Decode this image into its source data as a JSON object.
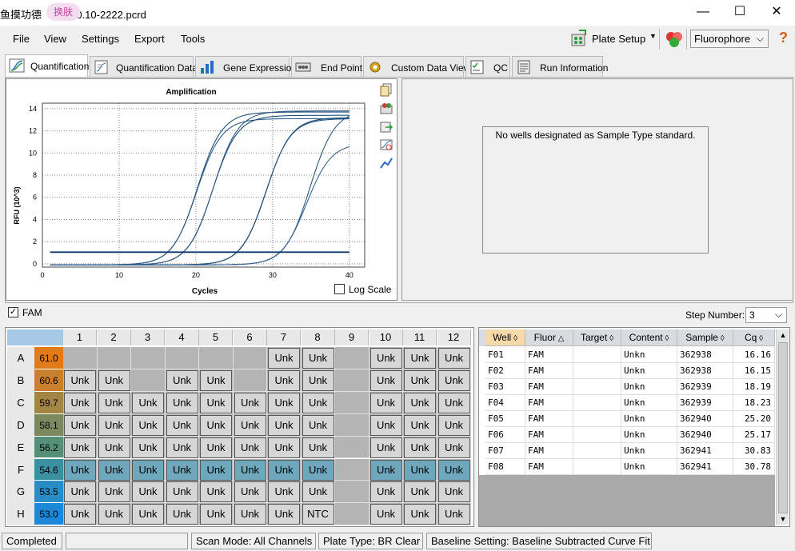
{
  "window": {
    "title": "鱼摸功德     s - 10.10-2222.pcrd",
    "skin_button": "换肤",
    "minimize": "—",
    "maximize": "☐",
    "close": "✕"
  },
  "menu": [
    "File",
    "View",
    "Settings",
    "Export",
    "Tools"
  ],
  "toolbar": {
    "plate_setup": "Plate Setup",
    "fluorophore": "Fluorophore",
    "help": "?"
  },
  "tabs": [
    {
      "label": "Quantification",
      "icon": "amplification-icon"
    },
    {
      "label": "Quantification Data",
      "icon": "data-sheet-icon"
    },
    {
      "label": "Gene Expression",
      "icon": "bar-chart-icon"
    },
    {
      "label": "End Point",
      "icon": "endpoint-icon"
    },
    {
      "label": "Custom Data View",
      "icon": "gear-icon"
    },
    {
      "label": "QC",
      "icon": "checklist-icon"
    },
    {
      "label": "Run Information",
      "icon": "document-icon"
    }
  ],
  "chart_data": {
    "type": "line",
    "title": "Amplification",
    "xlabel": "Cycles",
    "ylabel": "RFU (10^3)",
    "xlim": [
      0,
      42
    ],
    "ylim": [
      -0.3,
      14.5
    ],
    "xticks": [
      0,
      10,
      20,
      30,
      40
    ],
    "yticks": [
      0,
      2,
      4,
      6,
      8,
      10,
      12,
      14
    ],
    "threshold": 1.05,
    "log_scale": false,
    "log_scale_label": "Log Scale",
    "grid": true,
    "series": [
      {
        "cq": 16.16,
        "plateau": 13.8,
        "color": "#1f4e79"
      },
      {
        "cq": 16.15,
        "plateau": 13.2,
        "color": "#2b5d8c"
      },
      {
        "cq": 18.19,
        "plateau": 13.5,
        "color": "#1f4e79"
      },
      {
        "cq": 18.23,
        "plateau": 13.9,
        "color": "#355f88"
      },
      {
        "cq": 25.2,
        "plateau": 13.3,
        "color": "#1f4e79"
      },
      {
        "cq": 25.17,
        "plateau": 13.2,
        "color": "#24527f"
      },
      {
        "cq": 30.83,
        "plateau": 14.0,
        "color": "#2a5a85"
      },
      {
        "cq": 30.78,
        "plateau": 11.0,
        "color": "#3a6690"
      }
    ]
  },
  "standard_panel": {
    "message": "No wells designated as Sample Type standard."
  },
  "fam": {
    "label": "FAM",
    "checked": true
  },
  "step": {
    "label": "Step Number:",
    "value": "3"
  },
  "plate": {
    "columns": [
      "1",
      "2",
      "3",
      "4",
      "5",
      "6",
      "7",
      "8",
      "9",
      "10",
      "11",
      "12"
    ],
    "rows": [
      {
        "label": "A",
        "temp": "61.0",
        "color": "#e07b1a",
        "wells": [
          "",
          "",
          "",
          "",
          "",
          "",
          "Unk",
          "Unk",
          "",
          "Unk",
          "Unk",
          "Unk"
        ]
      },
      {
        "label": "B",
        "temp": "60.6",
        "color": "#c8802e",
        "wells": [
          "Unk",
          "Unk",
          "",
          "Unk",
          "Unk",
          "",
          "Unk",
          "Unk",
          "",
          "Unk",
          "Unk",
          "Unk"
        ]
      },
      {
        "label": "C",
        "temp": "59.7",
        "color": "#a38544",
        "wells": [
          "Unk",
          "Unk",
          "Unk",
          "Unk",
          "Unk",
          "Unk",
          "Unk",
          "Unk",
          "",
          "Unk",
          "Unk",
          "Unk"
        ]
      },
      {
        "label": "D",
        "temp": "58.1",
        "color": "#7b8a5e",
        "wells": [
          "Unk",
          "Unk",
          "Unk",
          "Unk",
          "Unk",
          "Unk",
          "Unk",
          "Unk",
          "",
          "Unk",
          "Unk",
          "Unk"
        ]
      },
      {
        "label": "E",
        "temp": "56.2",
        "color": "#548f79",
        "wells": [
          "Unk",
          "Unk",
          "Unk",
          "Unk",
          "Unk",
          "Unk",
          "Unk",
          "Unk",
          "",
          "Unk",
          "Unk",
          "Unk"
        ]
      },
      {
        "label": "F",
        "temp": "54.6",
        "color": "#3a90a0",
        "wells": [
          "Unk",
          "Unk",
          "Unk",
          "Unk",
          "Unk",
          "Unk",
          "Unk",
          "Unk",
          "",
          "Unk",
          "Unk",
          "Unk"
        ]
      },
      {
        "label": "G",
        "temp": "53.5",
        "color": "#2a8cc4",
        "wells": [
          "Unk",
          "Unk",
          "Unk",
          "Unk",
          "Unk",
          "Unk",
          "Unk",
          "Unk",
          "",
          "Unk",
          "Unk",
          "Unk"
        ]
      },
      {
        "label": "H",
        "temp": "53.0",
        "color": "#1e88d8",
        "wells": [
          "Unk",
          "Unk",
          "Unk",
          "Unk",
          "Unk",
          "Unk",
          "Unk",
          "NTC",
          "",
          "Unk",
          "Unk",
          "Unk"
        ]
      }
    ],
    "highlight_row": "F"
  },
  "table": {
    "headers": [
      "Well",
      "Fluor",
      "Target",
      "Content",
      "Sample",
      "Cq"
    ],
    "rows": [
      [
        "F01",
        "FAM",
        "",
        "Unkn",
        "362938",
        "16.16"
      ],
      [
        "F02",
        "FAM",
        "",
        "Unkn",
        "362938",
        "16.15"
      ],
      [
        "F03",
        "FAM",
        "",
        "Unkn",
        "362939",
        "18.19"
      ],
      [
        "F04",
        "FAM",
        "",
        "Unkn",
        "362939",
        "18.23"
      ],
      [
        "F05",
        "FAM",
        "",
        "Unkn",
        "362940",
        "25.20"
      ],
      [
        "F06",
        "FAM",
        "",
        "Unkn",
        "362940",
        "25.17"
      ],
      [
        "F07",
        "FAM",
        "",
        "Unkn",
        "362941",
        "30.83"
      ],
      [
        "F08",
        "FAM",
        "",
        "Unkn",
        "362941",
        "30.78"
      ]
    ]
  },
  "status": [
    "Completed",
    "",
    "Scan Mode: All Channels",
    "Plate Type: BR Clear",
    "Baseline Setting: Baseline Subtracted Curve Fit"
  ]
}
